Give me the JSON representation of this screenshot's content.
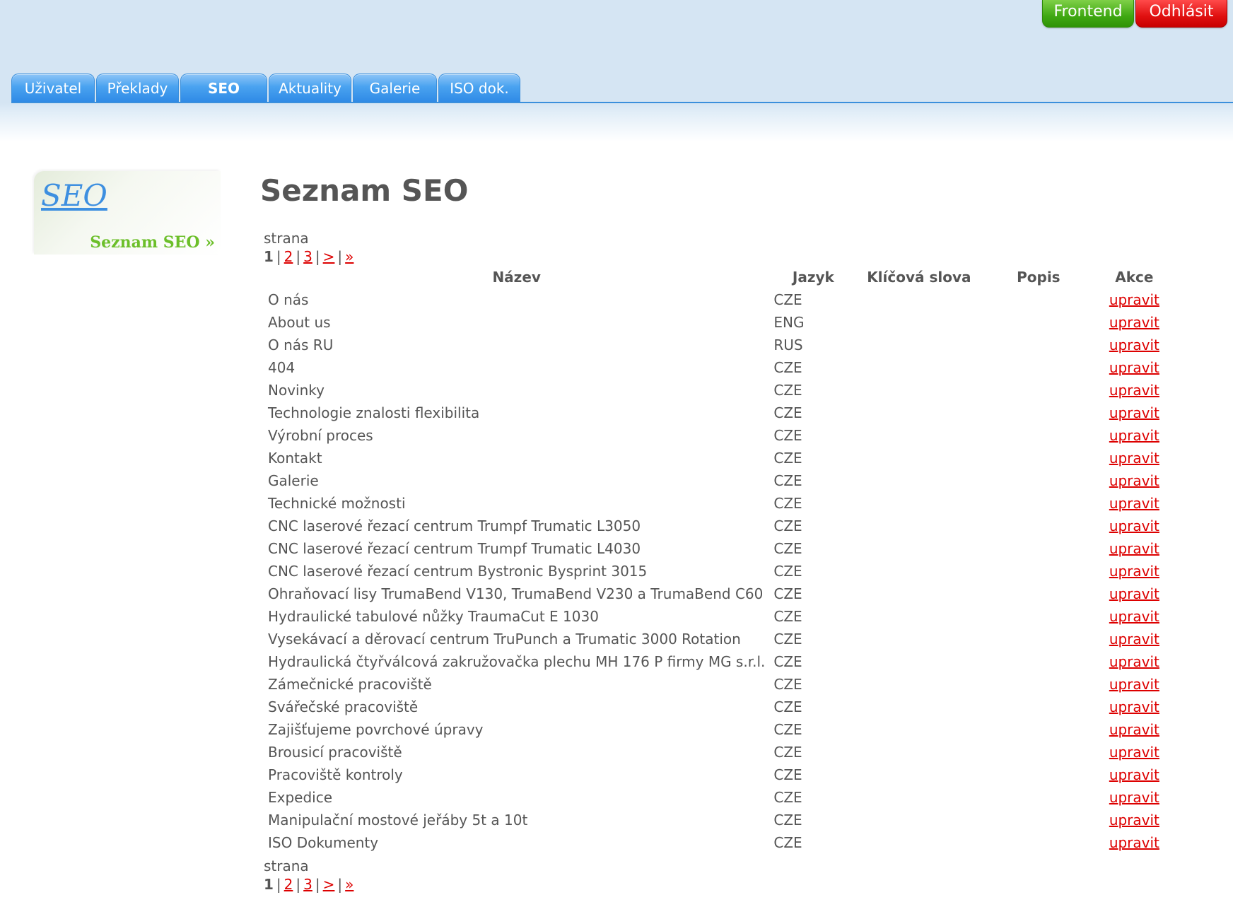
{
  "header": {
    "frontend_label": "Frontend",
    "logout_label": "Odhlásit",
    "tabs": [
      {
        "label": "Uživatel",
        "active": false
      },
      {
        "label": "Překlady",
        "active": false
      },
      {
        "label": "SEO",
        "active": true
      },
      {
        "label": "Aktuality",
        "active": false
      },
      {
        "label": "Galerie",
        "active": false
      },
      {
        "label": "ISO dok.",
        "active": false
      }
    ]
  },
  "sidebar": {
    "title": "SEO",
    "link": "Seznam SEO »"
  },
  "main": {
    "title": "Seznam SEO",
    "pager": {
      "label": "strana",
      "current": "1",
      "pages": [
        "2",
        "3"
      ],
      "next": ">",
      "last": "»"
    },
    "columns": [
      "Název",
      "Jazyk",
      "Klíčová slova",
      "Popis",
      "Akce"
    ],
    "action_label": "upravit",
    "rows": [
      {
        "name": "O nás",
        "lang": "CZE"
      },
      {
        "name": "About us",
        "lang": "ENG"
      },
      {
        "name": "O nás RU",
        "lang": "RUS"
      },
      {
        "name": "404",
        "lang": "CZE"
      },
      {
        "name": "Novinky",
        "lang": "CZE"
      },
      {
        "name": "Technologie znalosti flexibilita",
        "lang": "CZE"
      },
      {
        "name": "Výrobní proces",
        "lang": "CZE"
      },
      {
        "name": "Kontakt",
        "lang": "CZE"
      },
      {
        "name": "Galerie",
        "lang": "CZE"
      },
      {
        "name": "Technické možnosti",
        "lang": "CZE"
      },
      {
        "name": "CNC laserové řezací centrum Trumpf Trumatic L3050",
        "lang": "CZE"
      },
      {
        "name": "CNC laserové řezací centrum Trumpf Trumatic L4030",
        "lang": "CZE"
      },
      {
        "name": "CNC laserové řezací centrum Bystronic Bysprint 3015",
        "lang": "CZE"
      },
      {
        "name": "Ohraňovací lisy TrumaBend V130, TrumaBend V230 a TrumaBend C60",
        "lang": "CZE"
      },
      {
        "name": "Hydraulické tabulové nůžky TraumaCut E 1030",
        "lang": "CZE"
      },
      {
        "name": "Vysekávací a děrovací centrum TruPunch a Trumatic 3000 Rotation",
        "lang": "CZE"
      },
      {
        "name": "Hydraulická čtyřválcová zakružovačka plechu MH 176 P firmy MG s.r.l.",
        "lang": "CZE"
      },
      {
        "name": "Zámečnické pracoviště",
        "lang": "CZE"
      },
      {
        "name": "Svářečské pracoviště",
        "lang": "CZE"
      },
      {
        "name": "Zajišťujeme povrchové úpravy",
        "lang": "CZE"
      },
      {
        "name": "Brousicí pracoviště",
        "lang": "CZE"
      },
      {
        "name": "Pracoviště kontroly",
        "lang": "CZE"
      },
      {
        "name": "Expedice",
        "lang": "CZE"
      },
      {
        "name": "Manipulační mostové jeřáby 5t a 10t",
        "lang": "CZE"
      },
      {
        "name": "ISO Dokumenty",
        "lang": "CZE"
      }
    ]
  }
}
